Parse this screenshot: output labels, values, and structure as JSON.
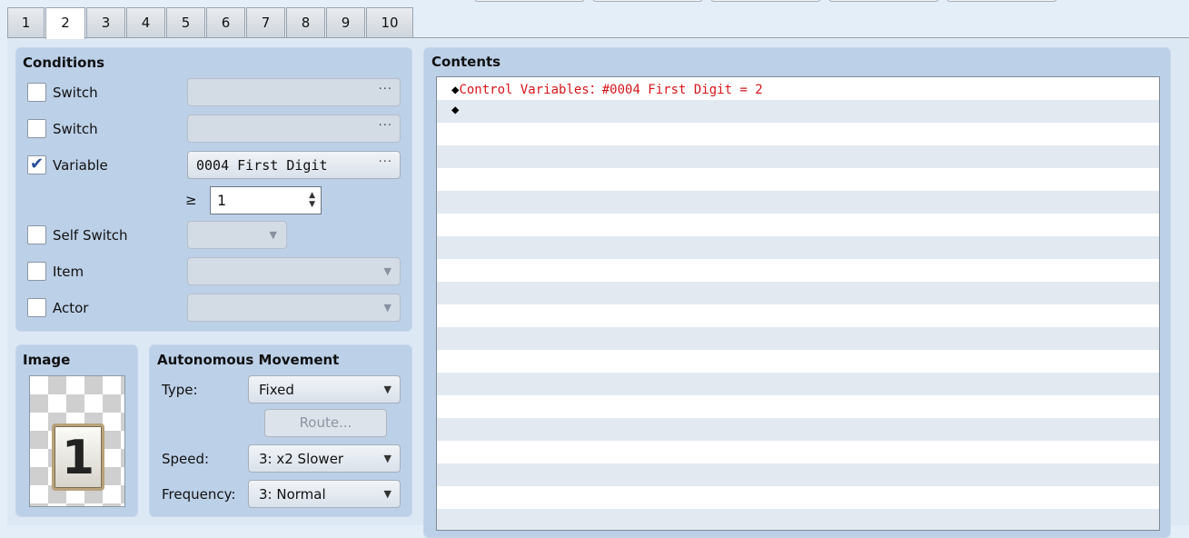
{
  "tabs": [
    "1",
    "2",
    "3",
    "4",
    "5",
    "6",
    "7",
    "8",
    "9",
    "10"
  ],
  "active_tab": "2",
  "conditions": {
    "title": "Conditions",
    "switch1": {
      "label": "Switch",
      "checked": false,
      "button": "···"
    },
    "switch2": {
      "label": "Switch",
      "checked": false,
      "button": "···"
    },
    "variable": {
      "label": "Variable",
      "checked": true,
      "value": "0004 First Digit",
      "button": "···",
      "operator": "≥",
      "amount": "1"
    },
    "self_switch": {
      "label": "Self Switch",
      "checked": false
    },
    "item": {
      "label": "Item",
      "checked": false
    },
    "actor": {
      "label": "Actor",
      "checked": false
    }
  },
  "image": {
    "title": "Image",
    "tile_text": "1"
  },
  "movement": {
    "title": "Autonomous Movement",
    "type_label": "Type:",
    "type_value": "Fixed",
    "route_button": "Route...",
    "speed_label": "Speed:",
    "speed_value": "3: x2 Slower",
    "frequency_label": "Frequency:",
    "frequency_value": "3: Normal"
  },
  "contents": {
    "title": "Contents",
    "lines": [
      {
        "marker": "◆",
        "text": "Control Variables：#0004 First Digit = 2"
      },
      {
        "marker": "◆",
        "text": ""
      }
    ]
  },
  "colors": {
    "accent": "#2a4f9a",
    "command_text": "#d8151b",
    "panel": "#bcd0e8"
  }
}
